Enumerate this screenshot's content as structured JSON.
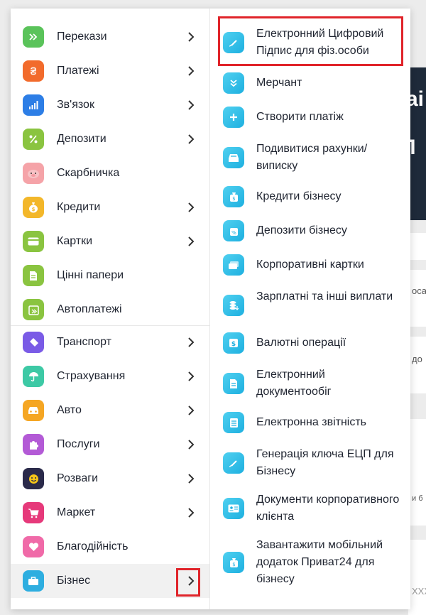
{
  "colors": {
    "highlight": "#e0242a",
    "accent": "#1eb0e0"
  },
  "left_menu": [
    {
      "label": "Перекази",
      "icon": "double-chevron-icon",
      "color": "#5ac35a",
      "has_arrow": true
    },
    {
      "label": "Платежі",
      "icon": "hryvnia-icon",
      "color": "#f26b2c",
      "has_arrow": true
    },
    {
      "label": "Зв'язок",
      "icon": "signal-bars-icon",
      "color": "#2d7ee6",
      "has_arrow": true
    },
    {
      "label": "Депозити",
      "icon": "percent-icon",
      "color": "#8ac440",
      "has_arrow": true
    },
    {
      "label": "Скарбничка",
      "icon": "piggy-bank-icon",
      "color": "#f5a3a8",
      "has_arrow": false
    },
    {
      "label": "Кредити",
      "icon": "money-bag-icon",
      "color": "#f3b72a",
      "has_arrow": true
    },
    {
      "label": "Картки",
      "icon": "card-icon",
      "color": "#8ac440",
      "has_arrow": true
    },
    {
      "label": "Цінні папери",
      "icon": "document-icon",
      "color": "#8ac440",
      "has_arrow": false
    },
    {
      "label": "Автоплатежі",
      "icon": "calendar-icon",
      "color": "#8ac440",
      "has_arrow": false
    },
    {
      "label": "Транспорт",
      "icon": "ticket-icon",
      "color": "#7a5be6",
      "has_arrow": true
    },
    {
      "label": "Страхування",
      "icon": "umbrella-icon",
      "color": "#3dc9a5",
      "has_arrow": true
    },
    {
      "label": "Авто",
      "icon": "car-icon",
      "color": "#f5a623",
      "has_arrow": true
    },
    {
      "label": "Послуги",
      "icon": "puzzle-icon",
      "color": "#b35ad6",
      "has_arrow": true
    },
    {
      "label": "Розваги",
      "icon": "smile-icon",
      "color": "#2a2a4a",
      "has_arrow": true
    },
    {
      "label": "Маркет",
      "icon": "cart-icon",
      "color": "#e6397a",
      "has_arrow": true
    },
    {
      "label": "Благодійність",
      "icon": "heart-icon",
      "color": "#f06aa8",
      "has_arrow": false
    },
    {
      "label": "Бізнес",
      "icon": "briefcase-icon",
      "color": "#2eaee0",
      "has_arrow": true,
      "active": true
    }
  ],
  "right_menu": [
    {
      "label": "Електронний Цифровий Підпис для фіз.особи",
      "icon": "pen-sign-icon"
    },
    {
      "label": "Мерчант",
      "icon": "double-chevron-down-icon"
    },
    {
      "label": "Створити платіж",
      "icon": "plus-icon"
    },
    {
      "label": "Подивитися рахунки/ виписку",
      "icon": "tray-icon"
    },
    {
      "label": "Кредити бізнесу",
      "icon": "credit-bag-icon"
    },
    {
      "label": "Депозити бізнесу",
      "icon": "deposit-percent-icon"
    },
    {
      "label": "Корпоративні картки",
      "icon": "cards-icon"
    },
    {
      "label": "Зарплатні та інші виплати",
      "icon": "coins-icon"
    },
    {
      "label": "Валютні операції",
      "icon": "dollar-icon"
    },
    {
      "label": "Електронний документообіг",
      "icon": "doc-icon"
    },
    {
      "label": "Електронна звітність",
      "icon": "report-icon"
    },
    {
      "label": "Генерація ключа ЕЦП для Бізнесу",
      "icon": "key-sign-icon"
    },
    {
      "label": "Документи корпоративного клієнта",
      "icon": "id-card-icon"
    },
    {
      "label": "Завантажити мобільний додаток Приват24 для бізнесу",
      "icon": "download-app-icon"
    }
  ],
  "background": {
    "banner_text_1": "ai",
    "banner_text_2": "з П",
    "snippet_1": "осал",
    "snippet_2": "до",
    "snippet_3": "и б",
    "snippet_4": "XXX"
  }
}
